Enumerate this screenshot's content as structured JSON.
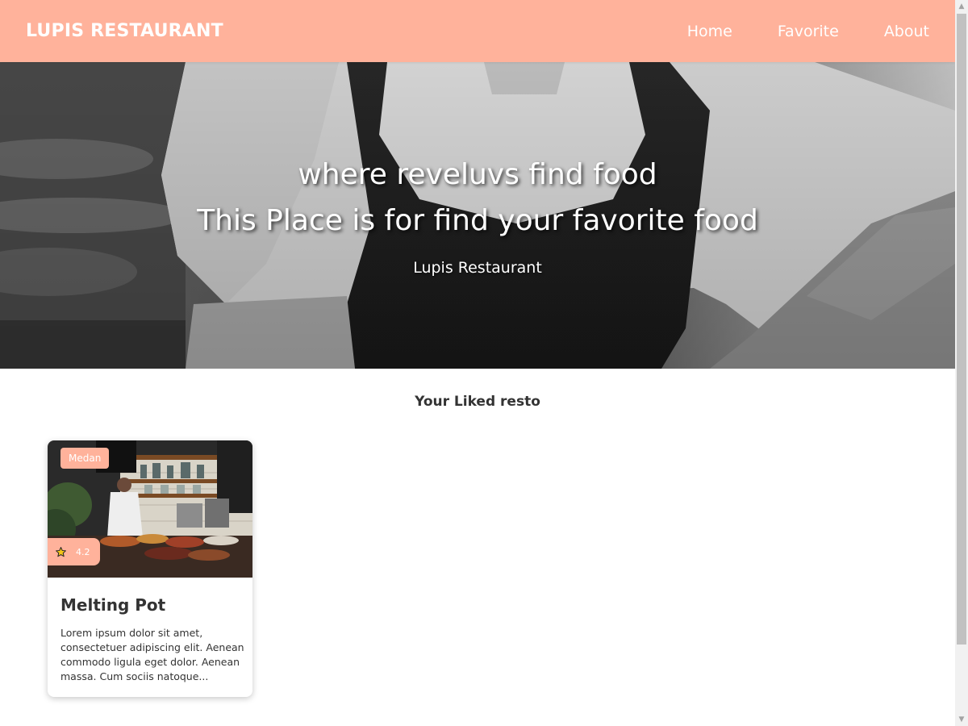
{
  "header": {
    "brand": "LUPIS RESTAURANT",
    "nav": [
      "Home",
      "Favorite",
      "About"
    ]
  },
  "hero": {
    "title_line1": "where reveluvs find food",
    "title_line2": "This Place is for find your favorite food",
    "subtitle": "Lupis Restaurant"
  },
  "favorites": {
    "section_title": "Your Liked resto",
    "cards": [
      {
        "city": "Medan",
        "rating": "4.2",
        "name": "Melting Pot",
        "description": "Lorem ipsum dolor sit amet, consectetuer adipiscing elit. Aenean commodo ligula eget dolor. Aenean massa. Cum sociis natoque..."
      }
    ]
  },
  "icons": {
    "rating": "star-icon",
    "scroll_up": "triangle-up-icon",
    "scroll_down": "triangle-down-icon"
  },
  "colors": {
    "accent": "#ffb29b",
    "text": "#333333",
    "white": "#ffffff"
  }
}
